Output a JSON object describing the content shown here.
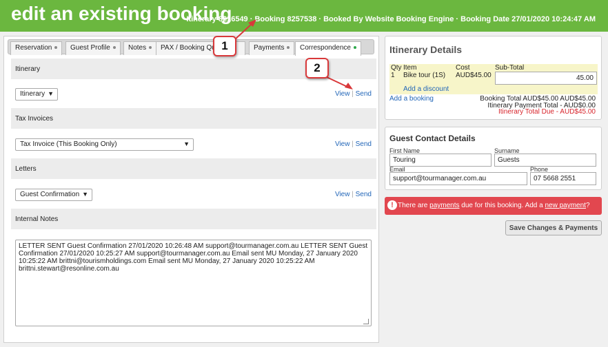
{
  "header": {
    "title": "edit an existing booking",
    "meta": "Itinerary 8216549 · Booking 8257538 · Booked By Website Booking Engine · Booking Date 27/01/2020 10:24:47 AM"
  },
  "tabs": [
    {
      "label": "Reservation",
      "active": false
    },
    {
      "label": "Guest Profile",
      "active": false
    },
    {
      "label": "Notes",
      "active": false
    },
    {
      "label": "PAX / Booking Qu",
      "active": false
    },
    {
      "label": "Payments",
      "active": false
    },
    {
      "label": "Correspondence",
      "active": true
    }
  ],
  "sections": {
    "itinerary": {
      "heading": "Itinerary",
      "select_value": "Itinerary"
    },
    "tax": {
      "heading": "Tax Invoices",
      "select_value": "Tax Invoice (This Booking Only)"
    },
    "letters": {
      "heading": "Letters",
      "select_value": "Guest Confirmation"
    },
    "notes": {
      "heading": "Internal Notes"
    }
  },
  "links": {
    "view": "View",
    "sep": "|",
    "send": "Send"
  },
  "notes_text": "LETTER SENT Guest Confirmation 27/01/2020 10:26:48 AM support@tourmanager.com.au LETTER SENT Guest Confirmation 27/01/2020 10:25:27 AM support@tourmanager.com.au  Email sent MU Monday, 27 January 2020 10:25:22 AM brittni@tourismholdings.com Email sent MU Monday, 27 January 2020 10:25:22 AM brittni.stewart@resonline.com.au",
  "itinerary_details": {
    "title": "Itinerary Details",
    "headers": {
      "qty": "Qty",
      "item": "Item",
      "cost": "Cost",
      "subtotal": "Sub-Total"
    },
    "line": {
      "qty": "1",
      "item": "Bike tour (1S)",
      "cost": "AUD$45.00",
      "subtotal": "45.00"
    },
    "add_discount": "Add a discount",
    "add_booking": "Add a booking",
    "totals": [
      {
        "label": "Booking Total",
        "value": "AUD$45.00 AUD$45.00"
      },
      {
        "label": "Itinerary Payment Total",
        "value": "-   AUD$0.00"
      },
      {
        "label": "Itinerary Total Due",
        "value": "-  AUD$45.00"
      }
    ]
  },
  "guest_contact": {
    "title": "Guest Contact Details",
    "first_name_label": "First Name",
    "first_name": "Touring",
    "surname_label": "Surname",
    "surname": "Guests",
    "email_label": "Email",
    "email": "support@tourmanager.com.au",
    "phone_label": "Phone",
    "phone": "07 5668 2551"
  },
  "alert": {
    "pre": "There are ",
    "payments": "payments",
    "mid": " due for this booking. Add a ",
    "new_payment": "new payment",
    "post": "?"
  },
  "save_button": "Save Changes & Payments",
  "callouts": {
    "one": "1",
    "two": "2"
  },
  "colors": {
    "header": "#6bb73f",
    "alert": "#e2474f",
    "link": "#2266b8"
  }
}
